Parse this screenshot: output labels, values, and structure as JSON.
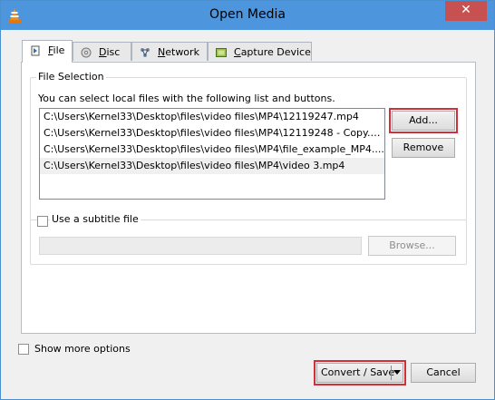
{
  "window": {
    "title": "Open Media",
    "close_label": "✕"
  },
  "tabs": [
    {
      "label_pre": "",
      "label_u": "F",
      "label_post": "ile"
    },
    {
      "label_pre": "",
      "label_u": "D",
      "label_post": "isc"
    },
    {
      "label_pre": "",
      "label_u": "N",
      "label_post": "etwork"
    },
    {
      "label_pre": "",
      "label_u": "C",
      "label_post": "apture Device"
    }
  ],
  "file_selection": {
    "group_title": "File Selection",
    "description": "You can select local files with the following list and buttons.",
    "files": [
      "C:\\Users\\Kernel33\\Desktop\\files\\video files\\MP4\\12119247.mp4",
      "C:\\Users\\Kernel33\\Desktop\\files\\video files\\MP4\\12119248 - Copy.m...",
      "C:\\Users\\Kernel33\\Desktop\\files\\video files\\MP4\\file_example_MP4....",
      "C:\\Users\\Kernel33\\Desktop\\files\\video files\\MP4\\video 3.mp4"
    ],
    "add_label": "Add...",
    "remove_label": "Remove"
  },
  "subtitle": {
    "checkbox_label": "Use a subtitle file",
    "browse_label": "Browse..."
  },
  "footer": {
    "show_more_label": "Show more options",
    "convert_label": "Convert / Save",
    "cancel_label": "Cancel"
  }
}
